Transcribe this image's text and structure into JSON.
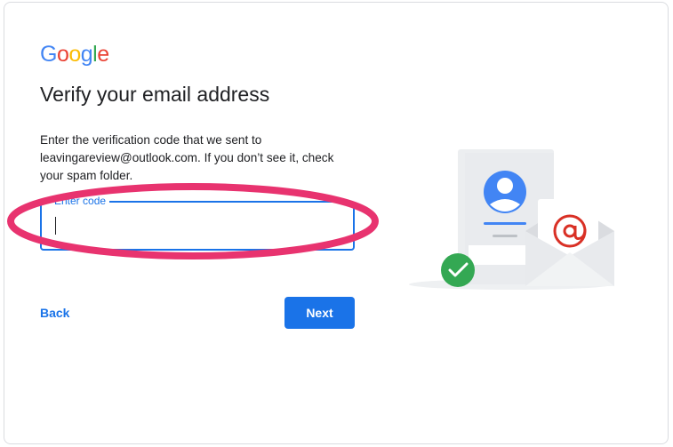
{
  "brand": {
    "logo_letters": [
      "G",
      "o",
      "o",
      "g",
      "l",
      "e"
    ],
    "logo_colors": [
      "#4285F4",
      "#EA4335",
      "#FBBC05",
      "#4285F4",
      "#34A853",
      "#EA4335"
    ]
  },
  "header": {
    "title": "Verify your email address"
  },
  "body": {
    "description": "Enter the verification code that we sent to leavingareview@outlook.com. If you don’t see it, check your spam folder."
  },
  "code_field": {
    "label": "Enter code",
    "value": ""
  },
  "actions": {
    "back_label": "Back",
    "next_label": "Next"
  },
  "colors": {
    "accent": "#1a73e8",
    "highlight": "#e8336f",
    "success": "#34A853",
    "at_sign": "#d93025"
  },
  "icons": {
    "profile": "user-avatar-icon",
    "email": "at-sign-icon",
    "check": "checkmark-icon"
  }
}
